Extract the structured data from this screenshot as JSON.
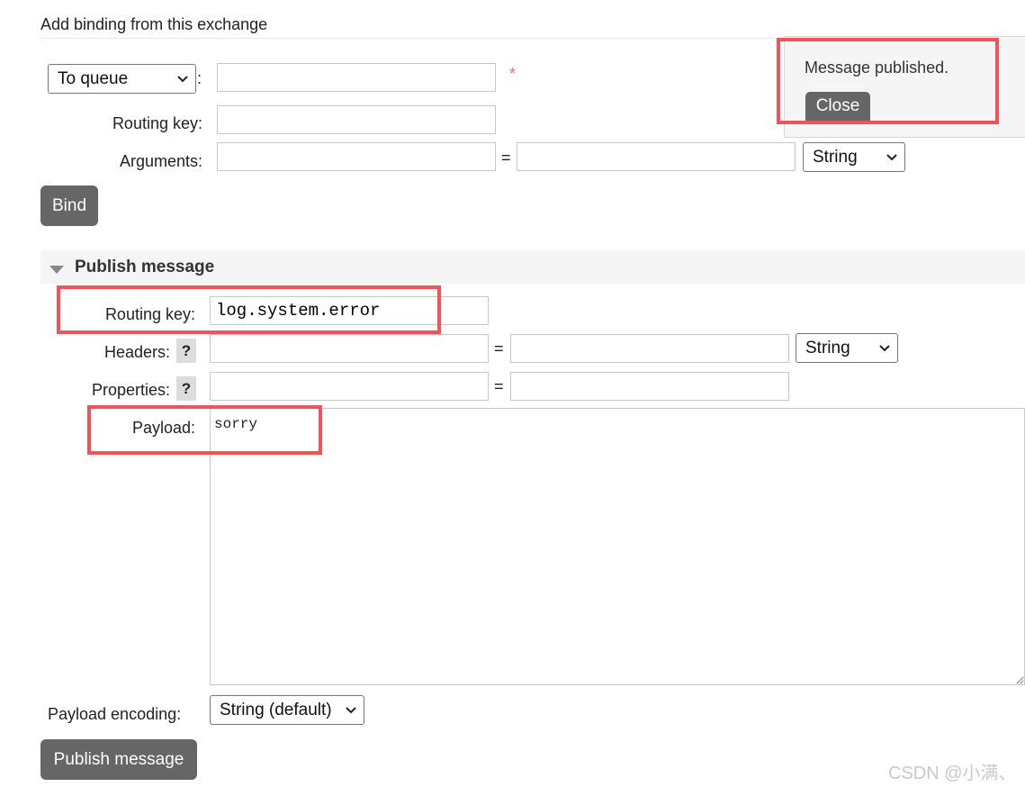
{
  "binding": {
    "heading": "Add binding from this exchange",
    "destination_type": "To queue",
    "colon": ":",
    "required_mark": "*",
    "routing_key_label": "Routing key:",
    "arguments_label": "Arguments:",
    "equals": "=",
    "arg_type": "String",
    "bind_button": "Bind"
  },
  "notification": {
    "message": "Message published.",
    "close_button": "Close"
  },
  "publish": {
    "section_title": "Publish message",
    "routing_key_label": "Routing key:",
    "routing_key_value": "log.system.error",
    "headers_label": "Headers:",
    "properties_label": "Properties:",
    "help_mark": "?",
    "equals": "=",
    "header_type": "String",
    "payload_label": "Payload:",
    "payload_value": "sorry",
    "encoding_label": "Payload encoding:",
    "encoding_value": "String (default)",
    "publish_button": "Publish message"
  },
  "watermark": "CSDN @小满、",
  "colors": {
    "button_bg": "#666666",
    "highlight_red": "#f2525a",
    "section_bg": "#f5f5f5"
  }
}
